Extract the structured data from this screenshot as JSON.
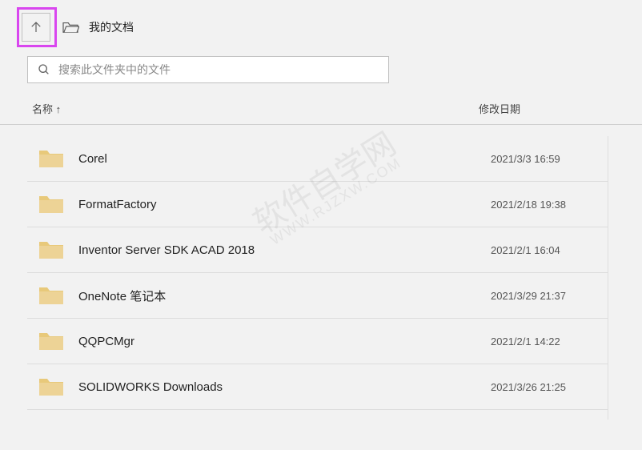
{
  "header": {
    "location": "我的文档"
  },
  "search": {
    "placeholder": "搜索此文件夹中的文件"
  },
  "columns": {
    "name": "名称 ↑",
    "date": "修改日期"
  },
  "files": [
    {
      "name": "Corel",
      "date": "2021/3/3 16:59"
    },
    {
      "name": "FormatFactory",
      "date": "2021/2/18 19:38"
    },
    {
      "name": "Inventor Server SDK ACAD 2018",
      "date": "2021/2/1 16:04"
    },
    {
      "name": "OneNote 笔记本",
      "date": "2021/3/29 21:37"
    },
    {
      "name": "QQPCMgr",
      "date": "2021/2/1 14:22"
    },
    {
      "name": "SOLIDWORKS Downloads",
      "date": "2021/3/26 21:25"
    }
  ],
  "watermark": {
    "main": "软件自学网",
    "sub": "WWW.RJZXW.COM"
  }
}
